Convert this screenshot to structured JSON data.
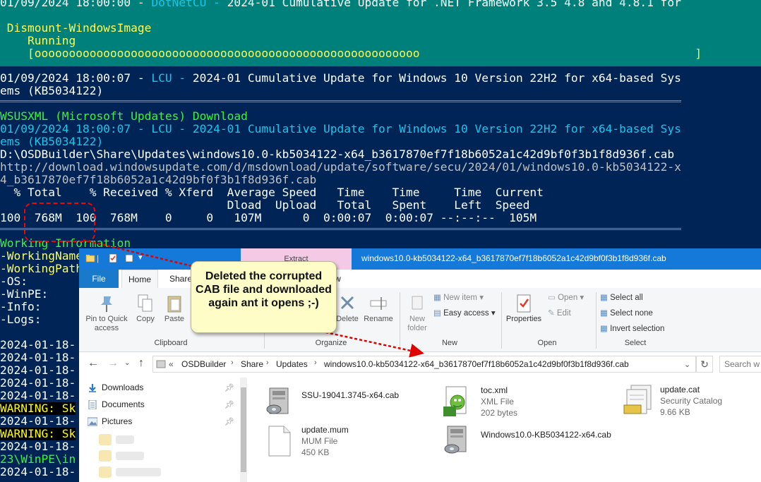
{
  "console": {
    "lines": [
      "01/09/2024 18:00:00 - DotNetCU - 2024-01 Cumulative Update for .NET Framework 3.5 4.8 and 4.8.1 for",
      " Dismount-WindowsImage",
      "    Running",
      "    [oooooooooooooooooooooooooooooooooooooooooooooooooooooooo                                        ]",
      "01/09/2024 18:00:07 - LCU - 2024-01 Cumulative Update for Windows 10 Version 22H2 for x64-based Sys",
      "ems (KB5034122)",
      "WSUSXML (Microsoft Updates) Download",
      "01/09/2024 18:00:07 - LCU - 2024-01 Cumulative Update for Windows 10 Version 22H2 for x64-based Sys",
      "ems (KB5034122)",
      "D:\\OSDBuilder\\Share\\Updates\\windows10.0-kb5034122-x64_b3617870ef7f18b6052a1c42d9bf0f3b1f8d936f.cab",
      "http://download.windowsupdate.com/d/msdownload/update/software/secu/2024/01/windows10.0-kb5034122-x",
      "4_b3617870ef7f18b6052a1c42d9bf0f3b1f8d936f.cab",
      "  % Total    % Received % Xferd  Average Speed   Time    Time     Time  Current",
      "                                 Dload  Upload   Total   Spent    Left  Speed",
      "100  768M  100  768M    0     0   107M      0  0:00:07  0:00:07 --:--:--  105M",
      "Working Information",
      "-WorkingName",
      "-WorkingPath",
      "-OS:",
      "-WinPE:",
      "-Info:",
      "-Logs:",
      "2024-01-18-",
      "2024-01-18-",
      "2024-01-18-",
      "2024-01-18-",
      "2024-01-18-",
      "WARNING: Sk",
      "2024-01-18-",
      "WARNING: Sk",
      "2024-01-18-",
      "23\\WinPE\\in",
      "2024-01-18-"
    ],
    "colors": {
      "background": "#012456",
      "band": "#00807a",
      "white": "#ffffff",
      "cyan": "#19c6ea",
      "yellow": "#ffff55",
      "green": "#3bf33b"
    }
  },
  "explorer": {
    "title": "windows10.0-kb5034122-x64_b3617870ef7f18b6052a1c42d9bf0f3b1f8d936f.cab",
    "contextual_tab": "Extract",
    "ribbon_tabs": [
      "File",
      "Home",
      "Share",
      "View"
    ],
    "ribbon": {
      "pin_to_quick_access": "Pin to Quick access",
      "copy": "Copy",
      "paste": "Paste",
      "delete": "Delete",
      "rename": "Rename",
      "new_folder": "New folder",
      "new_item": "New item",
      "easy_access": "Easy access",
      "properties": "Properties",
      "open": "Open",
      "edit": "Edit",
      "select_all": "Select all",
      "select_none": "Select none",
      "invert_selection": "Invert selection",
      "groups": [
        "Clipboard",
        "Organize",
        "New",
        "Open",
        "Select"
      ]
    },
    "breadcrumb": [
      "OSDBuilder",
      "Share",
      "Updates",
      "windows10.0-kb5034122-x64_b3617870ef7f18b6052a1c42d9bf0f3b1f8d936f.cab"
    ],
    "breadcrumb_overflow": "«",
    "search_placeholder": "Search w",
    "nav_items": [
      "Downloads",
      "Documents",
      "Pictures"
    ],
    "files": [
      {
        "name": "SSU-19041.3745-x64.cab",
        "type": "",
        "size": "",
        "icon": "cab-archive-icon"
      },
      {
        "name": "toc.xml",
        "type": "XML File",
        "size": "202 bytes",
        "icon": "xml-file-icon"
      },
      {
        "name": "update.cat",
        "type": "Security Catalog",
        "size": "9.66 KB",
        "icon": "security-catalog-icon"
      },
      {
        "name": "update.mum",
        "type": "MUM File",
        "size": "450 KB",
        "icon": "generic-file-icon"
      },
      {
        "name": "Windows10.0-KB5034122-x64.cab",
        "type": "",
        "size": "",
        "icon": "cab-archive-icon"
      }
    ]
  },
  "callout": {
    "text": "Deleted the corrupted CAB file and downloaded again ant it opens ;-)"
  }
}
